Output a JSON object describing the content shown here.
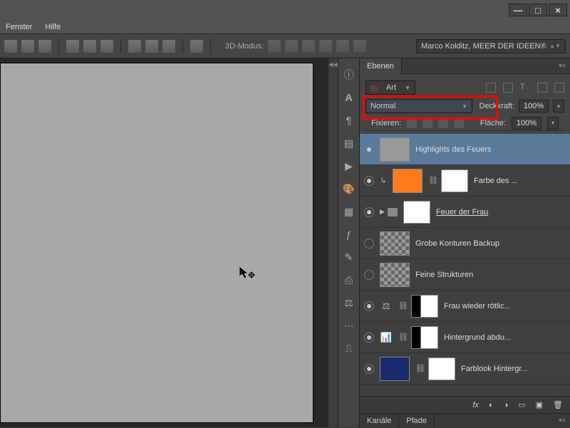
{
  "menu": {
    "fenster": "Fenster",
    "hilfe": "Hilfe"
  },
  "window": {
    "min": "—",
    "max": "□",
    "close": "×"
  },
  "toolbar": {
    "mode3d": "3D-Modus:",
    "docname": "Marco Kolditz, MEER DER IDEEN®"
  },
  "panels": {
    "layers_tab": "Ebenen",
    "blend_mode": "Normal",
    "opacity_label": "Deckkraft:",
    "opacity_value": "100%",
    "fill_label": "Fläche:",
    "fill_value": "100%",
    "lock_label": "Fixieren:"
  },
  "layers": [
    {
      "name": "Highlights des Feuers",
      "visible": true,
      "selected": true,
      "type": "plain",
      "thumb": "#9a9a9a"
    },
    {
      "name": "Farbe des ...",
      "visible": true,
      "type": "solid",
      "thumb": "#ff7a1a",
      "mask": "white",
      "clip": true
    },
    {
      "name": "Feuer der Frau",
      "visible": true,
      "type": "group",
      "underline": true
    },
    {
      "name": "Grobe Konturen Backup",
      "visible": false,
      "type": "plain",
      "thumb": "checker"
    },
    {
      "name": "Feine Strukturen",
      "visible": false,
      "type": "plain",
      "thumb": "checker"
    },
    {
      "name": "Frau wieder rötlic...",
      "visible": true,
      "type": "adj",
      "adjicon": "⚖",
      "mask": "bw"
    },
    {
      "name": "Hintergrund abdu...",
      "visible": true,
      "type": "adj",
      "adjicon": "📊",
      "mask": "bw"
    },
    {
      "name": "Farblook Hintergr...",
      "visible": true,
      "type": "solid",
      "thumb": "#1a2a6d",
      "mask": "bw2"
    }
  ],
  "bottom_tabs": {
    "kanale": "Kanäle",
    "pfade": "Pfade"
  },
  "bottom_icons": [
    "fx",
    "◐",
    "▭",
    "◯",
    "▦",
    "🗑"
  ]
}
